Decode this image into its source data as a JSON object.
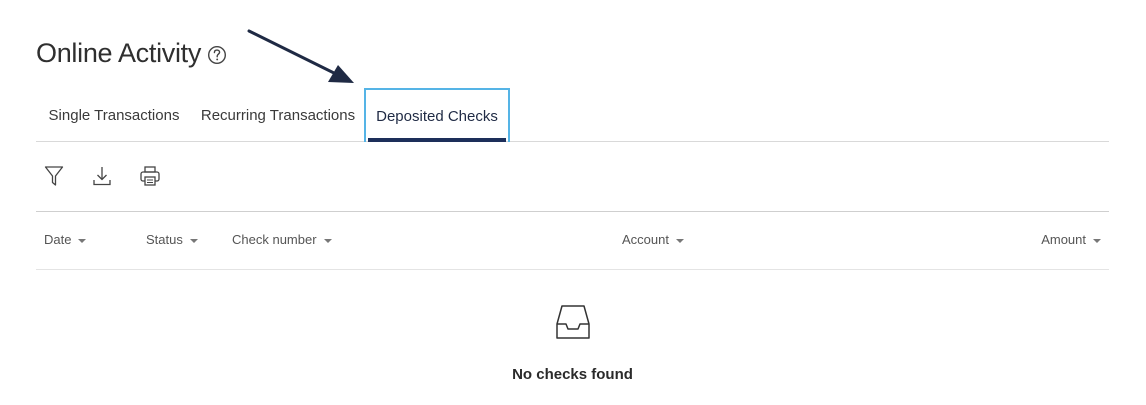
{
  "header": {
    "title": "Online Activity",
    "help_icon": "question-circle-icon"
  },
  "annotation": {
    "arrow_color": "#1f2a44"
  },
  "tabs": [
    {
      "label": "Single Transactions",
      "active": false
    },
    {
      "label": "Recurring Transactions",
      "active": false
    },
    {
      "label": "Deposited Checks",
      "active": true
    }
  ],
  "toolbar": {
    "icons": [
      "filter-icon",
      "download-icon",
      "print-icon"
    ]
  },
  "table": {
    "columns": [
      {
        "label": "Date"
      },
      {
        "label": "Status"
      },
      {
        "label": "Check number"
      },
      {
        "label": "Account"
      },
      {
        "label": "Amount"
      }
    ]
  },
  "empty_state": {
    "icon": "inbox-icon",
    "message": "No checks found"
  },
  "colors": {
    "active_tab_border": "#55b4e6",
    "active_tab_underline": "#1d2f5a"
  }
}
